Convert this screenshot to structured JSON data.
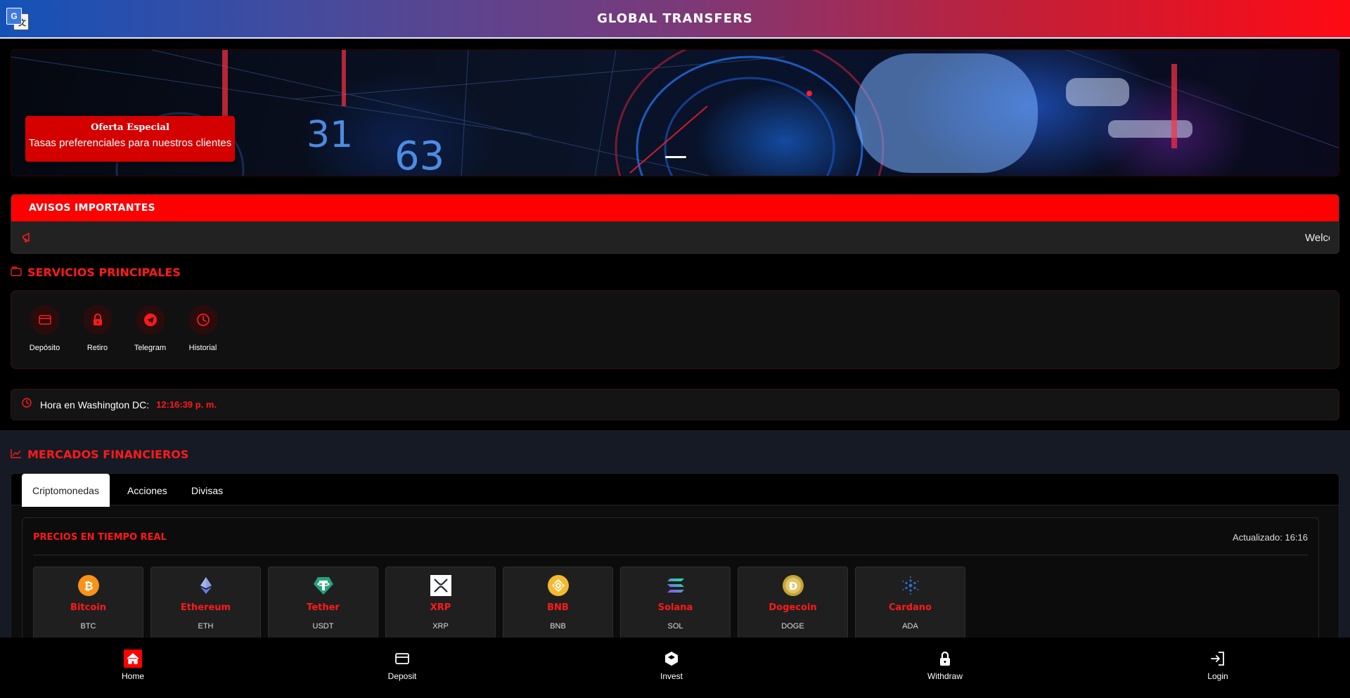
{
  "header": {
    "title": "GLOBAL TRANSFERS",
    "translate_icon": "google-translate-icon"
  },
  "banner": {
    "promo_title": "Oferta Especial",
    "promo_subtitle": "Tasas preferenciales para nuestros clientes",
    "numbers": [
      "31",
      "63"
    ]
  },
  "notices": {
    "title": "AVISOS IMPORTANTES",
    "icon": "megaphone-icon",
    "ticker_text": "Welcome"
  },
  "services": {
    "title": "SERVICIOS PRINCIPALES",
    "items": [
      {
        "label": "Depósito",
        "icon": "card-icon"
      },
      {
        "label": "Retiro",
        "icon": "lock-icon"
      },
      {
        "label": "Telegram",
        "icon": "telegram-icon"
      },
      {
        "label": "Historial",
        "icon": "clock-icon"
      }
    ]
  },
  "clock": {
    "label": "Hora en Washington DC:",
    "time": "12:16:39 p. m."
  },
  "markets": {
    "title": "MERCADOS FINANCIEROS",
    "tabs": [
      {
        "label": "Criptomonedas",
        "active": true
      },
      {
        "label": "Acciones",
        "active": false
      },
      {
        "label": "Divisas",
        "active": false
      }
    ],
    "prices_title": "PRECIOS EN TIEMPO REAL",
    "updated": "Actualizado: 16:16",
    "coins": [
      {
        "name": "Bitcoin",
        "symbol": "BTC",
        "color": "#f7931a"
      },
      {
        "name": "Ethereum",
        "symbol": "ETH",
        "color": "#627eea"
      },
      {
        "name": "Tether",
        "symbol": "USDT",
        "color": "#26a17b"
      },
      {
        "name": "XRP",
        "symbol": "XRP",
        "color": "#ffffff"
      },
      {
        "name": "BNB",
        "symbol": "BNB",
        "color": "#f3ba2f"
      },
      {
        "name": "Solana",
        "symbol": "SOL",
        "color": "#9945ff"
      },
      {
        "name": "Dogecoin",
        "symbol": "DOGE",
        "color": "#c2a633"
      },
      {
        "name": "Cardano",
        "symbol": "ADA",
        "color": "#2a71d0"
      }
    ]
  },
  "bottom_nav": {
    "items": [
      {
        "label": "Home",
        "icon": "home-icon"
      },
      {
        "label": "Deposit",
        "icon": "card-icon"
      },
      {
        "label": "Invest",
        "icon": "cube-icon"
      },
      {
        "label": "Withdraw",
        "icon": "lock-icon"
      },
      {
        "label": "Login",
        "icon": "login-icon"
      }
    ]
  },
  "colors": {
    "accent": "#ff0000",
    "header_left": "#1452b8",
    "header_right": "#ff0a14"
  }
}
